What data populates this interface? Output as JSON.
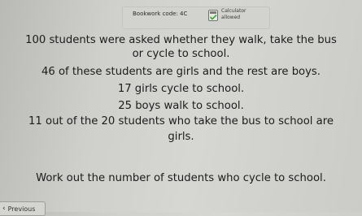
{
  "header": {
    "bookwork_code": "Bookwork code: 4C",
    "calculator_line1": "Calculator",
    "calculator_line2": "allowed",
    "calculator_icon": "calculator-check-icon"
  },
  "question": {
    "lines": [
      "100 students were asked whether they walk, take the bus",
      "or cycle to school.",
      "46 of these students are girls and the rest are boys.",
      "17 girls cycle to school.",
      "25 boys walk to school.",
      "11 out of the 20 students who take the bus to school are",
      "girls."
    ],
    "prompt": "Work out the number of students who cycle to school."
  },
  "nav": {
    "previous_label": "Previous",
    "previous_icon": "chevron-left-icon"
  }
}
